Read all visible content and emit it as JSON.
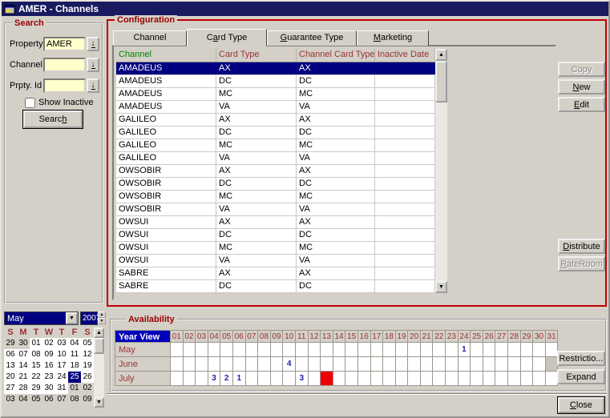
{
  "window": {
    "title": "AMER - Channels"
  },
  "colors": {
    "titlebar": "#181b60",
    "accent_red_border": "#c00000",
    "group_label_red": "#9b0000",
    "field_bg": "#ffffcc",
    "selection_bg": "#000080",
    "header_green": "#008200",
    "header_maroon": "#993333",
    "value_blue": "#2222aa",
    "alert_red": "#ef0000",
    "yearview_bg": "#0000bb",
    "window_bg": "#d4d0c8"
  },
  "search": {
    "box_label": "Search",
    "fields": [
      {
        "label": "Property",
        "value": "AMER"
      },
      {
        "label": "Channel",
        "value": ""
      },
      {
        "label": "Prpty. Id",
        "value": ""
      }
    ],
    "show_inactive_label": "Show Inactive",
    "show_inactive_checked": false,
    "search_button": {
      "label": "Search",
      "mnemonic": 5
    }
  },
  "configuration": {
    "box_label": "Configuration",
    "tabs": [
      {
        "label": "Channel",
        "mnemonic": -1,
        "active": false
      },
      {
        "label": "Card Type",
        "mnemonic": 1,
        "active": true
      },
      {
        "label": "Guarantee Type",
        "mnemonic": 0,
        "active": false
      },
      {
        "label": "Marketing",
        "mnemonic": 0,
        "active": false
      }
    ],
    "table": {
      "columns": [
        "Channel",
        "Card Type",
        "Channel Card Type",
        "Inactive Date"
      ],
      "selected_index": 0,
      "rows": [
        {
          "channel": "AMADEUS",
          "card_type": "AX",
          "channel_card_type": "AX",
          "inactive_date": ""
        },
        {
          "channel": "AMADEUS",
          "card_type": "DC",
          "channel_card_type": "DC",
          "inactive_date": ""
        },
        {
          "channel": "AMADEUS",
          "card_type": "MC",
          "channel_card_type": "MC",
          "inactive_date": ""
        },
        {
          "channel": "AMADEUS",
          "card_type": "VA",
          "channel_card_type": "VA",
          "inactive_date": ""
        },
        {
          "channel": "GALILEO",
          "card_type": "AX",
          "channel_card_type": "AX",
          "inactive_date": ""
        },
        {
          "channel": "GALILEO",
          "card_type": "DC",
          "channel_card_type": "DC",
          "inactive_date": ""
        },
        {
          "channel": "GALILEO",
          "card_type": "MC",
          "channel_card_type": "MC",
          "inactive_date": ""
        },
        {
          "channel": "GALILEO",
          "card_type": "VA",
          "channel_card_type": "VA",
          "inactive_date": ""
        },
        {
          "channel": "OWSOBIR",
          "card_type": "AX",
          "channel_card_type": "AX",
          "inactive_date": ""
        },
        {
          "channel": "OWSOBIR",
          "card_type": "DC",
          "channel_card_type": "DC",
          "inactive_date": ""
        },
        {
          "channel": "OWSOBIR",
          "card_type": "MC",
          "channel_card_type": "MC",
          "inactive_date": ""
        },
        {
          "channel": "OWSOBIR",
          "card_type": "VA",
          "channel_card_type": "VA",
          "inactive_date": ""
        },
        {
          "channel": "OWSUI",
          "card_type": "AX",
          "channel_card_type": "AX",
          "inactive_date": ""
        },
        {
          "channel": "OWSUI",
          "card_type": "DC",
          "channel_card_type": "DC",
          "inactive_date": ""
        },
        {
          "channel": "OWSUI",
          "card_type": "MC",
          "channel_card_type": "MC",
          "inactive_date": ""
        },
        {
          "channel": "OWSUI",
          "card_type": "VA",
          "channel_card_type": "VA",
          "inactive_date": ""
        },
        {
          "channel": "SABRE",
          "card_type": "AX",
          "channel_card_type": "AX",
          "inactive_date": ""
        },
        {
          "channel": "SABRE",
          "card_type": "DC",
          "channel_card_type": "DC",
          "inactive_date": ""
        }
      ]
    },
    "buttons": [
      {
        "label": "Copy",
        "mnemonic": -1,
        "enabled": false
      },
      {
        "label": "New",
        "mnemonic": 0,
        "enabled": true
      },
      {
        "label": "Edit",
        "mnemonic": 0,
        "enabled": true
      },
      {
        "label": "Distribute",
        "mnemonic": 0,
        "enabled": true
      },
      {
        "label": "RateRoom",
        "mnemonic": 0,
        "enabled": false
      }
    ]
  },
  "availability": {
    "box_label": "Availability",
    "header_label": "Year View",
    "day_columns": [
      "01",
      "02",
      "03",
      "04",
      "05",
      "06",
      "07",
      "08",
      "09",
      "10",
      "11",
      "12",
      "13",
      "14",
      "15",
      "16",
      "17",
      "18",
      "19",
      "20",
      "21",
      "22",
      "23",
      "24",
      "25",
      "26",
      "27",
      "28",
      "29",
      "30",
      "31"
    ],
    "months": [
      {
        "name": "May",
        "values": {
          "24": "1"
        },
        "gray_days": [],
        "red_days": []
      },
      {
        "name": "June",
        "values": {
          "10": "4"
        },
        "gray_days": [
          31
        ],
        "red_days": []
      },
      {
        "name": "July",
        "values": {
          "4": "3",
          "5": "2",
          "6": "1",
          "11": "3"
        },
        "gray_days": [],
        "red_days": [
          13
        ]
      }
    ],
    "restrictions_button": {
      "label": "Restrictio...",
      "mnemonic": -1
    },
    "expand_button": {
      "label": "Expand",
      "mnemonic": -1
    }
  },
  "calendar": {
    "month": "May",
    "year": "2007",
    "day_headers": [
      "S",
      "M",
      "T",
      "W",
      "T",
      "F",
      "S"
    ],
    "weeks": [
      [
        {
          "d": "29",
          "o": 1
        },
        {
          "d": "30",
          "o": 1
        },
        {
          "d": "01"
        },
        {
          "d": "02"
        },
        {
          "d": "03"
        },
        {
          "d": "04"
        },
        {
          "d": "05"
        }
      ],
      [
        {
          "d": "06"
        },
        {
          "d": "07"
        },
        {
          "d": "08"
        },
        {
          "d": "09"
        },
        {
          "d": "10"
        },
        {
          "d": "11"
        },
        {
          "d": "12"
        }
      ],
      [
        {
          "d": "13"
        },
        {
          "d": "14"
        },
        {
          "d": "15"
        },
        {
          "d": "16"
        },
        {
          "d": "17"
        },
        {
          "d": "18"
        },
        {
          "d": "19"
        }
      ],
      [
        {
          "d": "20"
        },
        {
          "d": "21"
        },
        {
          "d": "22"
        },
        {
          "d": "23"
        },
        {
          "d": "24"
        },
        {
          "d": "25",
          "sel": 1
        },
        {
          "d": "26"
        }
      ],
      [
        {
          "d": "27"
        },
        {
          "d": "28"
        },
        {
          "d": "29"
        },
        {
          "d": "30"
        },
        {
          "d": "31"
        },
        {
          "d": "01",
          "o": 1
        },
        {
          "d": "02",
          "o": 1
        }
      ],
      [
        {
          "d": "03",
          "o": 1
        },
        {
          "d": "04",
          "o": 1
        },
        {
          "d": "05",
          "o": 1
        },
        {
          "d": "06",
          "o": 1
        },
        {
          "d": "07",
          "o": 1
        },
        {
          "d": "08",
          "o": 1
        },
        {
          "d": "09",
          "o": 1
        }
      ]
    ]
  },
  "close_button": {
    "label": "Close",
    "mnemonic": 0
  }
}
